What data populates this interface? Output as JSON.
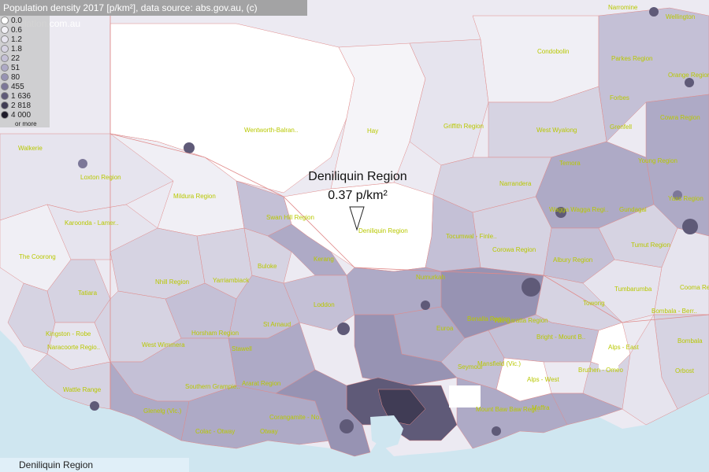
{
  "title": "Population density 2017 [p/km²], data source: abs.gov.au, (c) population.com.au",
  "legend": {
    "items": [
      {
        "label": "0.0",
        "color": "#ffffff"
      },
      {
        "label": "0.6",
        "color": "#f2f1f6"
      },
      {
        "label": "1.2",
        "color": "#e6e4ee"
      },
      {
        "label": "1.8",
        "color": "#d6d3e2"
      },
      {
        "label": "22",
        "color": "#c4c0d6"
      },
      {
        "label": "51",
        "color": "#aeaac6"
      },
      {
        "label": "80",
        "color": "#9793b3"
      },
      {
        "label": "455",
        "color": "#7c7798"
      },
      {
        "label": "1 636",
        "color": "#5f5a78"
      },
      {
        "label": "2 818",
        "color": "#403c55"
      },
      {
        "label": "4 000",
        "color": "#1e1b2a"
      }
    ],
    "more_label": "or more"
  },
  "tooltip": {
    "name": "Deniliquin Region",
    "value": "0.37 p/km²"
  },
  "footer": {
    "selected_region": "Deniliquin Region"
  },
  "regions": [
    {
      "name": "Narromine"
    },
    {
      "name": "Wellington"
    },
    {
      "name": "Condobolin"
    },
    {
      "name": "Parkes Region"
    },
    {
      "name": "Orange Region"
    },
    {
      "name": "Forbes"
    },
    {
      "name": "Cowra Region"
    },
    {
      "name": "Griffith Region"
    },
    {
      "name": "West Wyalong"
    },
    {
      "name": "Grenfell"
    },
    {
      "name": "Wentworth-Balran.."
    },
    {
      "name": "Hay"
    },
    {
      "name": "Young Region"
    },
    {
      "name": "Temora"
    },
    {
      "name": "Walkerie"
    },
    {
      "name": "Narrandera"
    },
    {
      "name": "Loxton Region"
    },
    {
      "name": "Mildura Region"
    },
    {
      "name": "Deniliquin Region"
    },
    {
      "name": "Wagga Wagga Regi.."
    },
    {
      "name": "Gundagai"
    },
    {
      "name": "Yass Region"
    },
    {
      "name": "Karoonda - Lamer.."
    },
    {
      "name": "Swan Hill Region"
    },
    {
      "name": "Tocumwal - Finle.."
    },
    {
      "name": "Corowa Region"
    },
    {
      "name": "Tumut Region"
    },
    {
      "name": "The Coorong"
    },
    {
      "name": "Kerang"
    },
    {
      "name": "Albury Region"
    },
    {
      "name": "Buloke"
    },
    {
      "name": "Nhill Region"
    },
    {
      "name": "Yarriambiack"
    },
    {
      "name": "Numurkah"
    },
    {
      "name": "Tumbarumba"
    },
    {
      "name": "Cooma Region"
    },
    {
      "name": "Tatiara"
    },
    {
      "name": "Loddon"
    },
    {
      "name": "Towong"
    },
    {
      "name": "Benalla Region"
    },
    {
      "name": "Wangaratta Region"
    },
    {
      "name": "Bombala - Berr.."
    },
    {
      "name": "Kingston - Robe"
    },
    {
      "name": "St Arnaud"
    },
    {
      "name": "Euroa"
    },
    {
      "name": "Bright - Mount B.."
    },
    {
      "name": "Naracoorte Regio.."
    },
    {
      "name": "West Wimmera"
    },
    {
      "name": "Horsham Region"
    },
    {
      "name": "Alps - East"
    },
    {
      "name": "Bombala"
    },
    {
      "name": "Stawell"
    },
    {
      "name": "Mansfield (Vic.)"
    },
    {
      "name": "Bruthen - Omeo"
    },
    {
      "name": "Seymour"
    },
    {
      "name": "Orbost"
    },
    {
      "name": "Southern Grampie.."
    },
    {
      "name": "Ararat Region"
    },
    {
      "name": "Alps - West"
    },
    {
      "name": "Wattle Range"
    },
    {
      "name": "Mount Baw Baw Regi.."
    },
    {
      "name": "Glenelg (Vic.)"
    },
    {
      "name": "Maffra"
    },
    {
      "name": "Corangamite - No.."
    },
    {
      "name": "Colac - Otway"
    },
    {
      "name": "Otway"
    }
  ]
}
